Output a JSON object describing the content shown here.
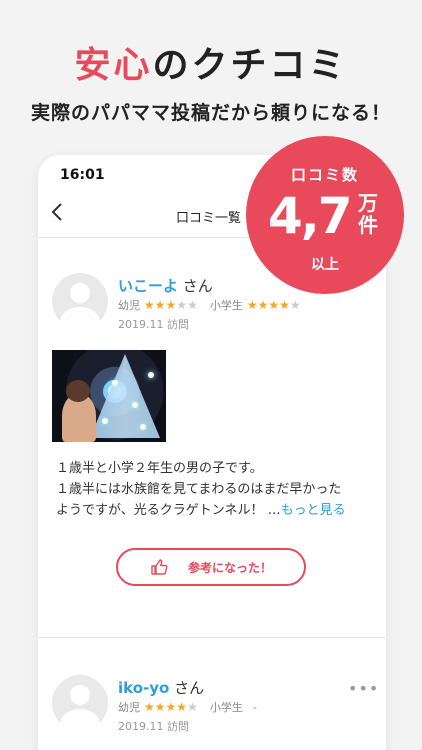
{
  "headline": {
    "accent": "安心",
    "rest": "のクチコミ"
  },
  "subheadline": "実際のパパママ投稿だから頼りになる！",
  "phone": {
    "status_time": "16:01",
    "nav_title": "口コミ一覧"
  },
  "badge": {
    "top": "口コミ数",
    "number": "4,7",
    "unit": "万件",
    "bottom": "以上"
  },
  "reviews": [
    {
      "name": "いこーよ",
      "honorific": "さん",
      "age_label_1": "幼児",
      "rating_1": 3,
      "age_label_2": "小学生",
      "rating_2": 4,
      "date": "2019.11 訪問",
      "text_lines": [
        "１歳半と小学２年生の男の子です。",
        "１歳半には水族館を見てまわるのはまだ早かった",
        "ようですが、光るクラゲトンネル！ …"
      ],
      "more_label": "もっと見る",
      "helpful_label": "参考になった！"
    },
    {
      "name": "iko-yo",
      "honorific": "さん",
      "age_label_1": "幼児",
      "rating_1": 4,
      "age_label_2": "小学生",
      "rating_2_text": "-",
      "date": "2019.11 訪問",
      "menu_icon": "more-dots-icon"
    }
  ],
  "colors": {
    "accent": "#e8495b",
    "link": "#2b9fd9",
    "star_on": "#f5a623",
    "star_off": "#cccccc"
  }
}
